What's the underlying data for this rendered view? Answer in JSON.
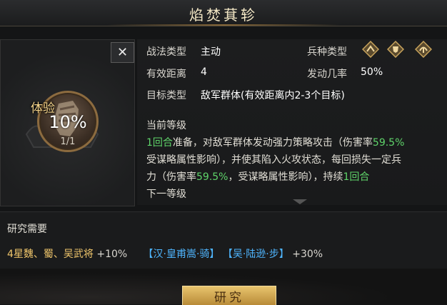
{
  "title": "焰焚萁轸",
  "close_label": "✕",
  "skill_card": {
    "trial_label": "体验",
    "percent": "10%",
    "count": "1/1"
  },
  "info": {
    "type_label": "战法类型",
    "type_value": "主动",
    "range_label": "有效距离",
    "range_value": "4",
    "target_label": "目标类型",
    "target_value": "敌军群体(有效距离内2-3个目标)",
    "troop_label": "兵种类型",
    "chance_label": "发动几率",
    "chance_value": "50%",
    "troop_icons": [
      "cavalry-icon",
      "shield-icon",
      "archer-icon"
    ]
  },
  "description": {
    "current_level_label": "当前等级",
    "line1_a": "1回合",
    "line1_b": "准备，对敌军群体发动强力策略攻击（伤害率",
    "line1_c": "59.5%",
    "line2": "受谋略属性影响），并使其陷入火攻状态，每回损失一定兵",
    "line3_a": "力（伤害率",
    "line3_b": "59.5%",
    "line3_c": "，受谋略属性影响），持续",
    "line3_d": "1回合",
    "next_level_label": "下一等级"
  },
  "research": {
    "title": "研究需要",
    "base": "4星魏、蜀、吴武将",
    "base_bonus": "+10%",
    "gen1": "【汉·皇甫嵩·骑】",
    "gen2": "【吴·陆逊·步】",
    "gen_bonus": "+30%",
    "button_label": "研究"
  },
  "colors": {
    "accent_gold": "#f0c66b",
    "highlight_green": "#5fd46a",
    "general_blue": "#4fb6ff"
  }
}
